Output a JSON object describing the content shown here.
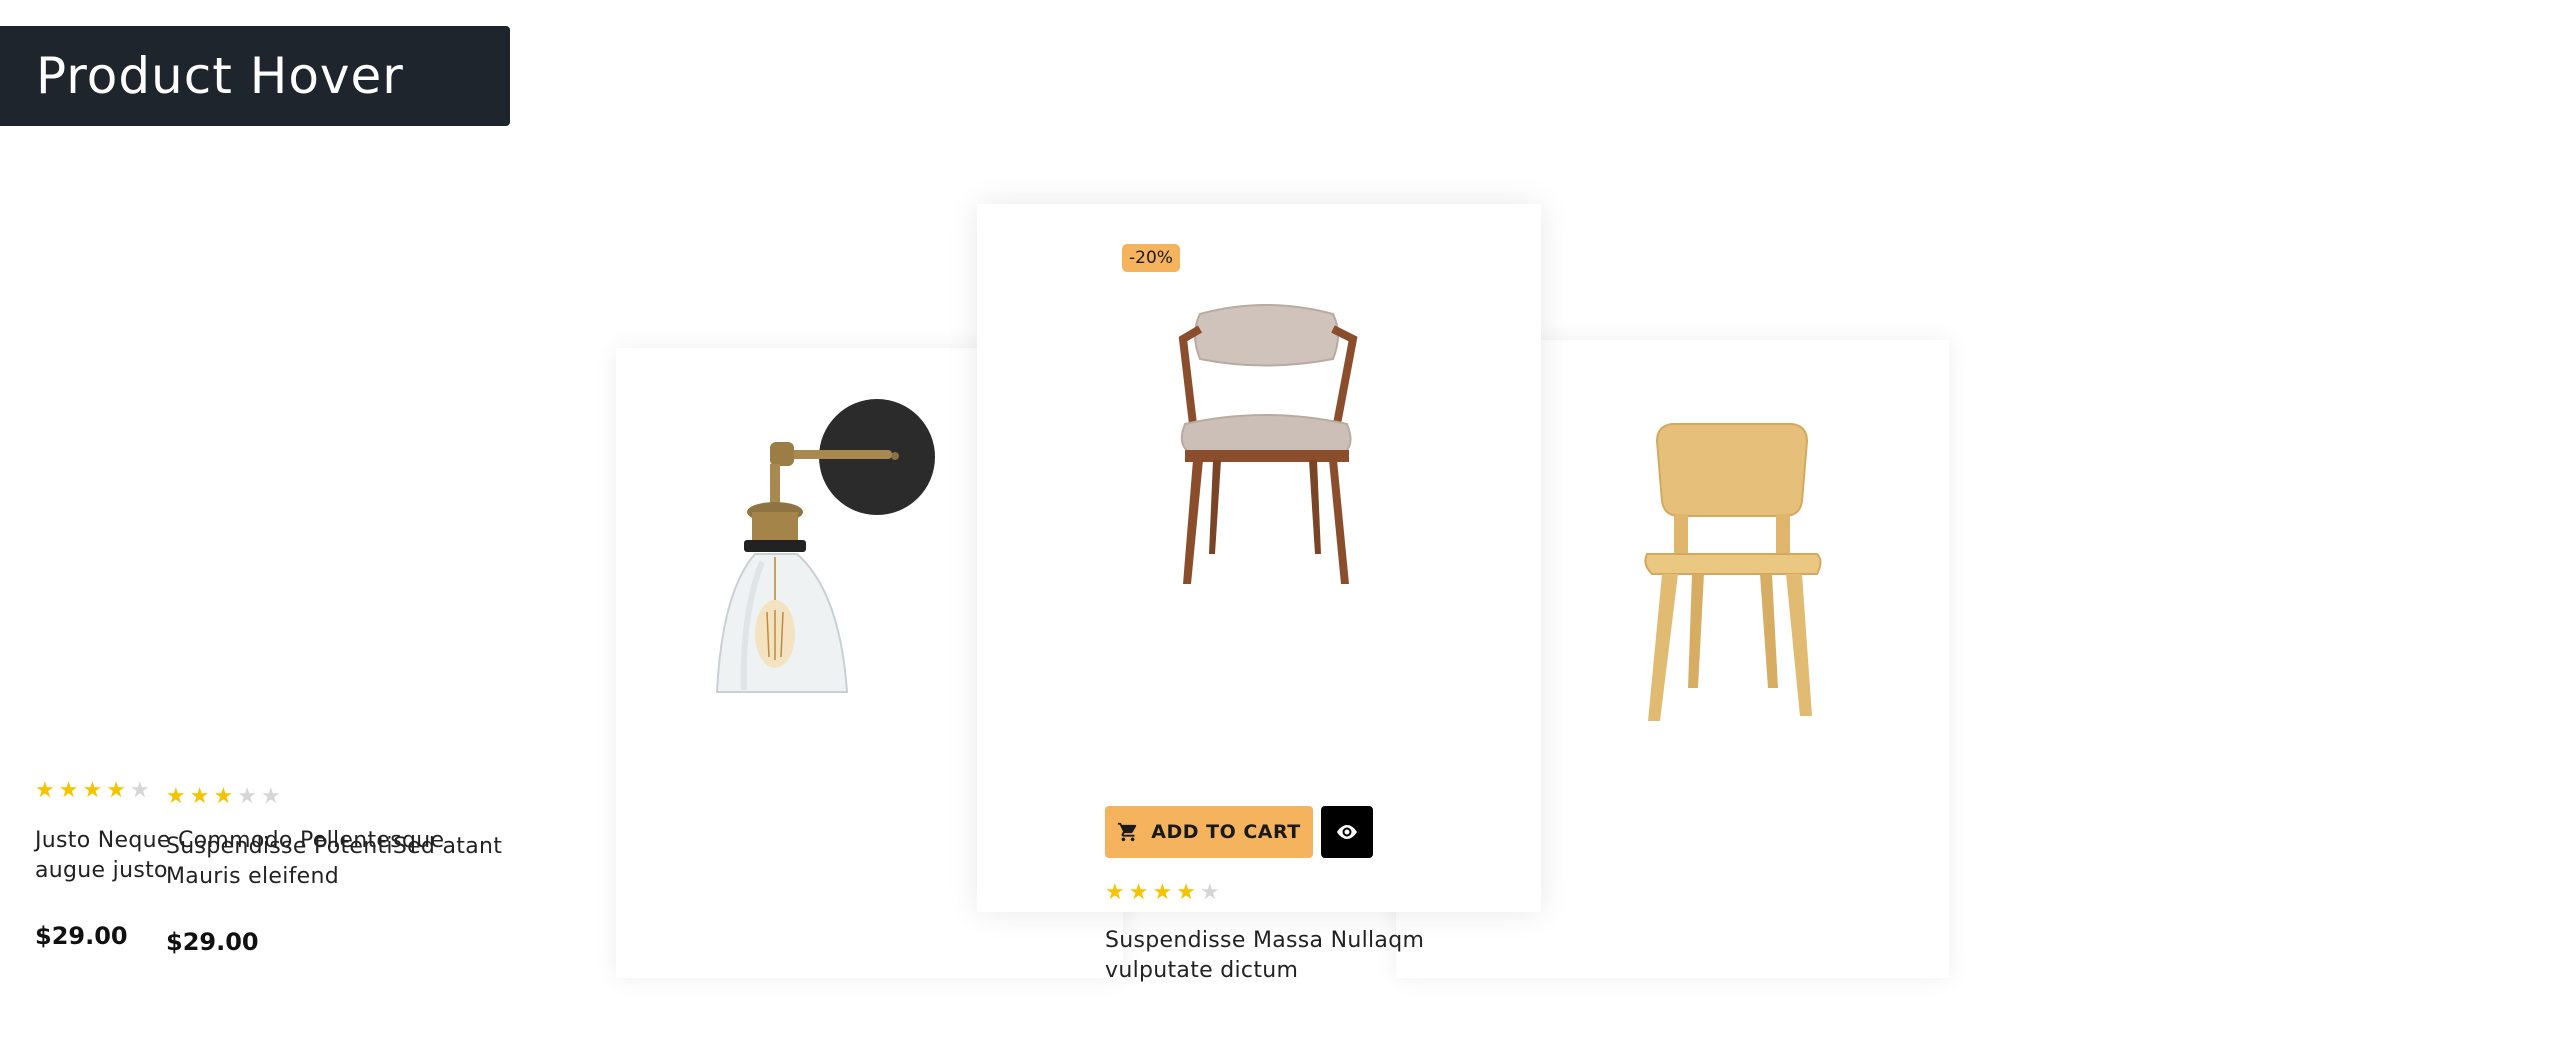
{
  "header": {
    "title": "Product Hover"
  },
  "products": [
    {
      "name": "Justo Neque Commodo Pellentesque augue justo",
      "price": "$29.00",
      "rating": 4,
      "image": "wall-lamp"
    },
    {
      "name": "Suspendisse Massa Nullaqm vulputate dictum",
      "badge": "-20%",
      "rating": 4,
      "image": "upholstered-chair",
      "add_to_cart_label": "ADD TO CART"
    },
    {
      "name": "Suspendisse PotentiSed atant Mauris eleifend",
      "price": "$29.00",
      "rating": 3,
      "image": "wooden-chair"
    }
  ],
  "colors": {
    "banner": "#1f252d",
    "accent": "#f6b35e",
    "star_on": "#f5c400",
    "star_off": "#d6d6d6"
  }
}
